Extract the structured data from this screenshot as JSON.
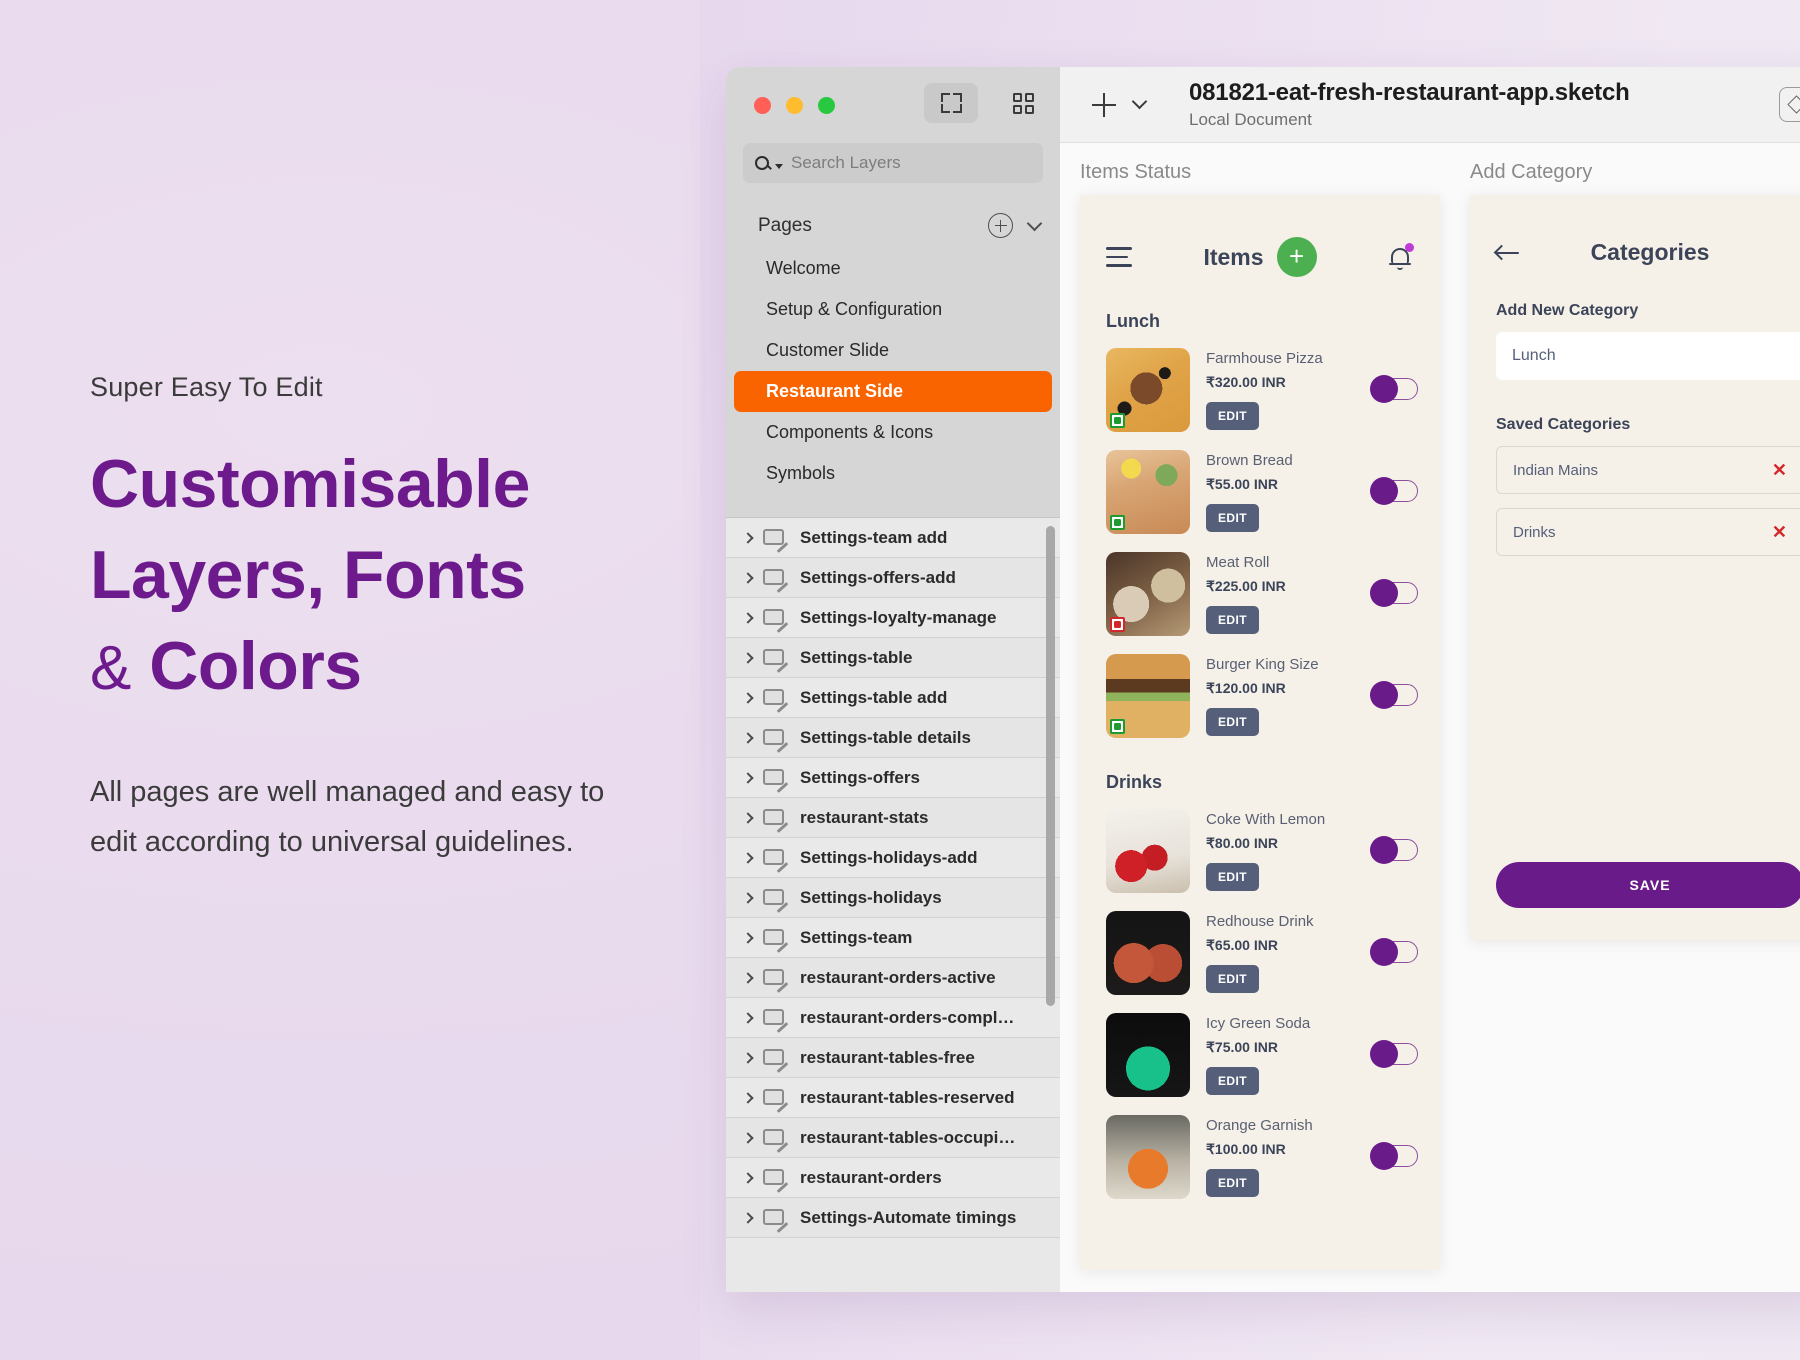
{
  "promo": {
    "eyebrow": "Super Easy To Edit",
    "headline_line1": "Customisable",
    "headline_line2": "Layers, Fonts",
    "headline_amp": "&",
    "headline_line3": "Colors",
    "body": "All pages are well managed and easy to edit according to universal guidelines.",
    "accent_color": "#6d1b8c",
    "text_color": "#3b3b3b",
    "background_color": "#eadcee"
  },
  "sketch_window": {
    "traffic_lights": [
      "close",
      "minimize",
      "zoom"
    ],
    "view_toggle": {
      "canvas_label": "canvas-view",
      "grid_label": "grid-view",
      "active": "canvas-view"
    },
    "search": {
      "placeholder": "Search Layers",
      "value": ""
    },
    "pages": {
      "label": "Pages",
      "add_label": "+",
      "items": [
        {
          "label": "Welcome",
          "selected": false
        },
        {
          "label": "Setup & Configuration",
          "selected": false
        },
        {
          "label": "Customer Slide",
          "selected": false
        },
        {
          "label": "Restaurant Side",
          "selected": true
        },
        {
          "label": "Components & Icons",
          "selected": false
        },
        {
          "label": "Symbols",
          "selected": false
        }
      ],
      "selected_color": "#fa6400"
    },
    "layers": [
      {
        "label": "Settings-team add"
      },
      {
        "label": "Settings-offers-add"
      },
      {
        "label": "Settings-loyalty-manage"
      },
      {
        "label": "Settings-table"
      },
      {
        "label": "Settings-table add"
      },
      {
        "label": "Settings-table details"
      },
      {
        "label": "Settings-offers"
      },
      {
        "label": "restaurant-stats"
      },
      {
        "label": "Settings-holidays-add"
      },
      {
        "label": "Settings-holidays"
      },
      {
        "label": "Settings-team"
      },
      {
        "label": "restaurant-orders-active"
      },
      {
        "label": "restaurant-orders-compl…"
      },
      {
        "label": "restaurant-tables-free"
      },
      {
        "label": "restaurant-tables-reserved"
      },
      {
        "label": "restaurant-tables-occupi…"
      },
      {
        "label": "restaurant-orders"
      },
      {
        "label": "Settings-Automate timings"
      }
    ],
    "document": {
      "title": "081821-eat-fresh-restaurant-app.sketch",
      "subtitle": "Local Document",
      "add_label": "+"
    }
  },
  "canvas": {
    "artboards": [
      {
        "name": "Items Status"
      },
      {
        "name": "Add Category"
      }
    ],
    "items_screen": {
      "title": "Items",
      "add_label": "+",
      "sections": [
        {
          "title": "Lunch",
          "items": [
            {
              "name": "Farmhouse Pizza",
              "price": "₹320.00 INR",
              "diet": "veg",
              "edit_label": "EDIT",
              "toggle_on": true,
              "thumb": "th-pizza"
            },
            {
              "name": "Brown Bread",
              "price": "₹55.00 INR",
              "diet": "veg",
              "edit_label": "EDIT",
              "toggle_on": true,
              "thumb": "th-bread"
            },
            {
              "name": "Meat Roll",
              "price": "₹225.00 INR",
              "diet": "nonveg",
              "edit_label": "EDIT",
              "toggle_on": true,
              "thumb": "th-roll"
            },
            {
              "name": "Burger King Size",
              "price": "₹120.00 INR",
              "diet": "veg",
              "edit_label": "EDIT",
              "toggle_on": true,
              "thumb": "th-burger"
            }
          ]
        },
        {
          "title": "Drinks",
          "items": [
            {
              "name": "Coke With Lemon",
              "price": "₹80.00 INR",
              "diet": "none",
              "edit_label": "EDIT",
              "toggle_on": true,
              "thumb": "th-coke"
            },
            {
              "name": "Redhouse Drink",
              "price": "₹65.00 INR",
              "diet": "none",
              "edit_label": "EDIT",
              "toggle_on": true,
              "thumb": "th-red"
            },
            {
              "name": "Icy Green Soda",
              "price": "₹75.00 INR",
              "diet": "none",
              "edit_label": "EDIT",
              "toggle_on": true,
              "thumb": "th-green"
            },
            {
              "name": "Orange Garnish",
              "price": "₹100.00 INR",
              "diet": "none",
              "edit_label": "EDIT",
              "toggle_on": true,
              "thumb": "th-orange"
            }
          ]
        }
      ]
    },
    "categories_screen": {
      "title": "Categories",
      "add_new_label": "Add New Category",
      "input_value": "Lunch",
      "saved_label": "Saved Categories",
      "saved": [
        {
          "name": "Indian Mains",
          "remove_label": "✕"
        },
        {
          "name": "Drinks",
          "remove_label": "✕"
        }
      ],
      "save_label": "SAVE",
      "save_color": "#6a1b8a"
    }
  }
}
